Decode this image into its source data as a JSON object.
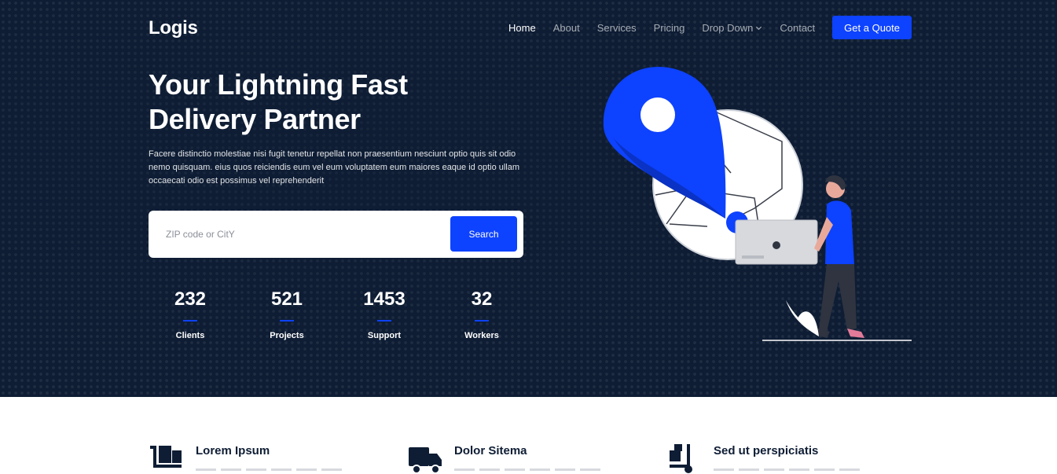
{
  "brand": {
    "logo": "Logis",
    "accent": "#0d42ff",
    "background": "#0e1d34"
  },
  "nav": {
    "items": [
      {
        "label": "Home",
        "active": true
      },
      {
        "label": "About"
      },
      {
        "label": "Services"
      },
      {
        "label": "Pricing"
      },
      {
        "label": "Drop Down",
        "icon": "chevron-down-icon"
      },
      {
        "label": "Contact"
      }
    ],
    "cta": "Get a Quote"
  },
  "hero": {
    "title_line1": "Your Lightning Fast",
    "title_line2": "Delivery Partner",
    "description": "Facere distinctio molestiae nisi fugit tenetur repellat non praesentium nesciunt optio quis sit odio nemo quisquam. eius quos reiciendis eum vel eum voluptatem eum maiores eaque id optio ullam occaecati odio est possimus vel reprehenderit",
    "search": {
      "placeholder": "ZIP code or CitY",
      "value": "",
      "button": "Search"
    },
    "stats": [
      {
        "value": "232",
        "label": "Clients"
      },
      {
        "value": "521",
        "label": "Projects"
      },
      {
        "value": "1453",
        "label": "Support"
      },
      {
        "value": "32",
        "label": "Workers"
      }
    ],
    "illustration": "location-pin-delivery-person-illustration"
  },
  "features": [
    {
      "title": "Lorem Ipsum",
      "icon": "boxes-icon"
    },
    {
      "title": "Dolor Sitema",
      "icon": "truck-icon"
    },
    {
      "title": "Sed ut perspiciatis",
      "icon": "hand-truck-icon"
    }
  ]
}
